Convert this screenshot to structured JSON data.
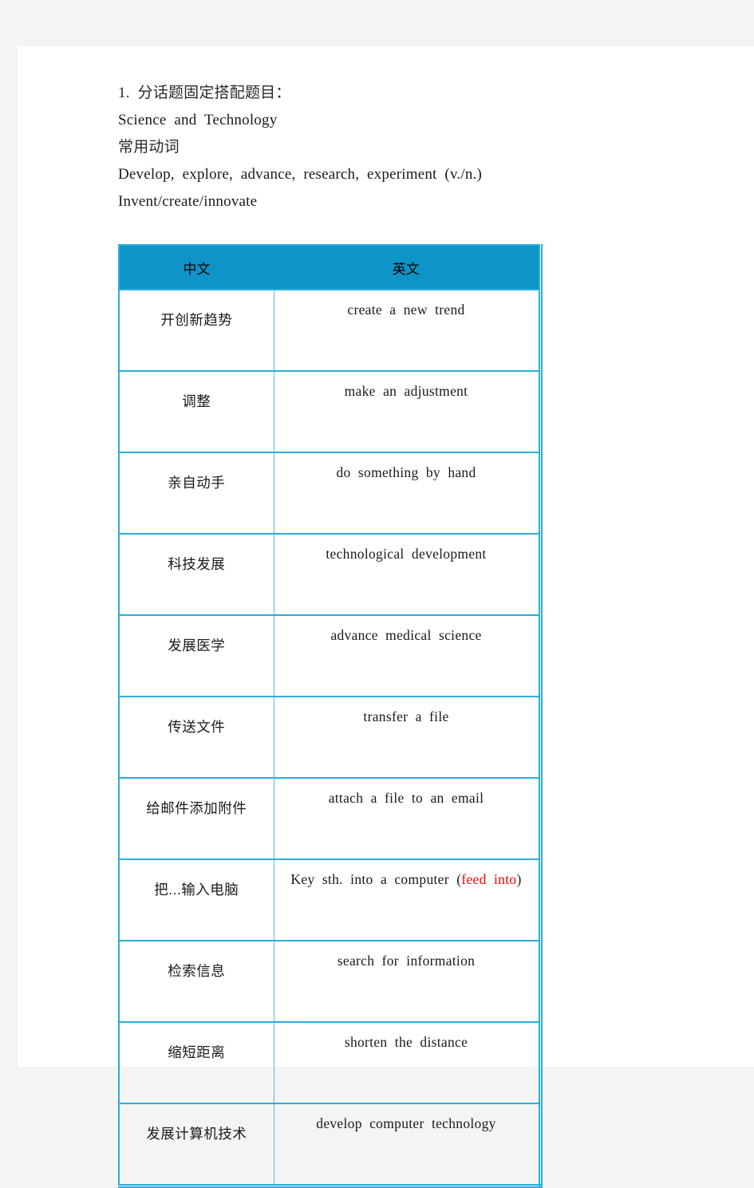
{
  "document": {
    "intro_lines": [
      {
        "text": "1.  分话题固定搭配题目：",
        "script": "cjk"
      },
      {
        "text": "Science  and  Technology",
        "script": "latin"
      },
      {
        "text": "常用动词",
        "script": "cjk"
      },
      {
        "text": "Develop,  explore,  advance,  research,  experiment  (v./n.)",
        "script": "latin"
      },
      {
        "text": "Invent/create/innovate",
        "script": "latin"
      }
    ],
    "table": {
      "headers": {
        "chinese": "中文",
        "english": "英文"
      },
      "header_bg": "#0f94c8",
      "border_color": "#2badda",
      "accent_color": "#ff0000",
      "rows": [
        {
          "cn": "开创新趋势",
          "en": "create  a  new  trend",
          "en_accent": "",
          "en_suffix": ""
        },
        {
          "cn": "调整",
          "en": "make  an  adjustment",
          "en_accent": "",
          "en_suffix": ""
        },
        {
          "cn": "亲自动手",
          "en": "do  something  by  hand",
          "en_accent": "",
          "en_suffix": ""
        },
        {
          "cn": "科技发展",
          "en": "technological  development",
          "en_accent": "",
          "en_suffix": ""
        },
        {
          "cn": "发展医学",
          "en": "advance  medical  science",
          "en_accent": "",
          "en_suffix": ""
        },
        {
          "cn": "传送文件",
          "en": "transfer  a  file",
          "en_accent": "",
          "en_suffix": ""
        },
        {
          "cn": "给邮件添加附件",
          "en": "attach  a  file  to  an  email",
          "en_accent": "",
          "en_suffix": ""
        },
        {
          "cn": "把...输入电脑",
          "en": "Key  sth.  into  a  computer  (",
          "en_accent": "feed  into",
          "en_suffix": ")"
        },
        {
          "cn": "检索信息",
          "en": "search  for  information",
          "en_accent": "",
          "en_suffix": ""
        },
        {
          "cn": "缩短距离",
          "en": "shorten  the  distance",
          "en_accent": "",
          "en_suffix": ""
        },
        {
          "cn": "发展计算机技术",
          "en": "develop  computer  technology",
          "en_accent": "",
          "en_suffix": ""
        }
      ]
    }
  }
}
